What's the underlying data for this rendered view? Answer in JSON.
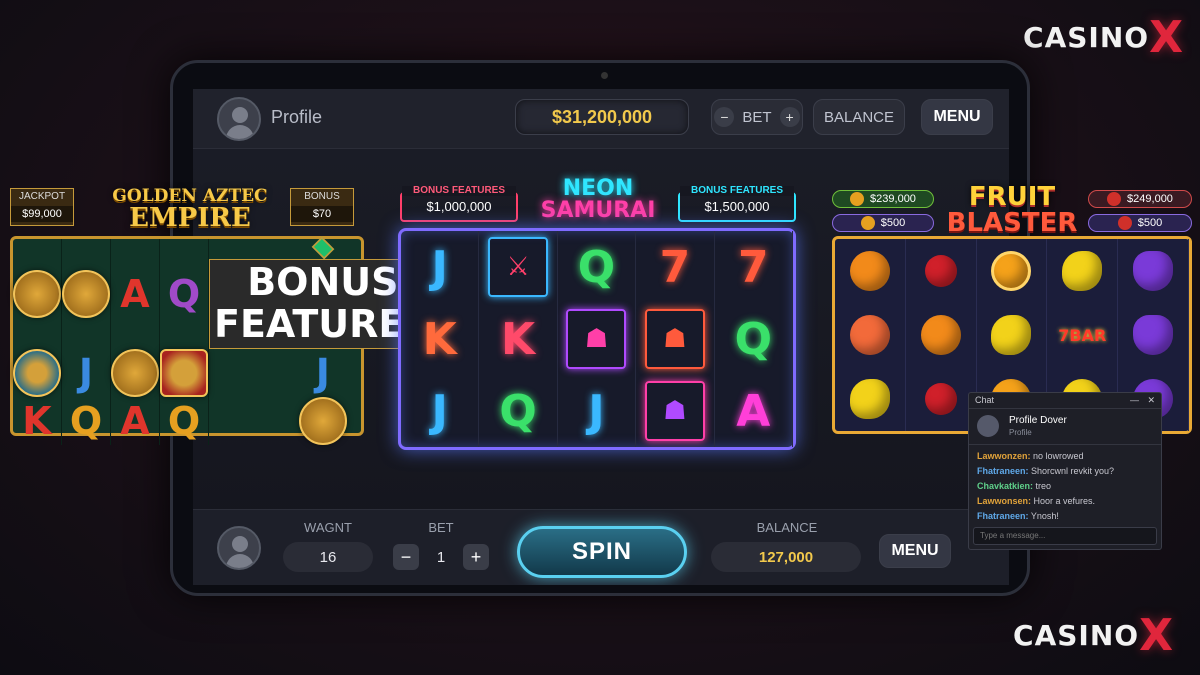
{
  "brand": {
    "logo_text": "CASINO",
    "logo_mark": "X"
  },
  "topbar": {
    "profile_label": "Profile",
    "jackpot_value": "$31,200,000",
    "bet_label": "BET",
    "minus": "−",
    "plus": "+",
    "balance_label": "BALANCE",
    "menu_label": "MENU"
  },
  "aztec": {
    "title_line1": "GOLDEN AZTEC",
    "title_line2": "EMPIRE",
    "jackpot_label": "JACKPOT",
    "jackpot_value": "$99,000",
    "bonus_label": "BONUS",
    "bonus_value": "$70",
    "bonus_cell_l1": "BONUS",
    "bonus_cell_l2": "FEATURES",
    "letters": [
      "A",
      "Q",
      "J",
      "J",
      "K",
      "Q",
      "A",
      "Q"
    ]
  },
  "neon": {
    "title_line1": "NEON",
    "title_line2": "SAMURAI",
    "left_tag_label": "BONUS FEATURES",
    "left_tag_value": "$1,000,000",
    "right_tag_label": "BONUS FEATURES",
    "right_tag_value": "$1,500,000",
    "cells": [
      "J",
      "⚔",
      "Q",
      "7",
      "7",
      "K",
      "K",
      "☗",
      "☗",
      "Q",
      "J",
      "Q",
      "J",
      "☗",
      "A"
    ]
  },
  "fruit": {
    "title_line1": "FRUIT",
    "title_line2": "BLASTER",
    "tag1": "$239,000",
    "tag2": "$500",
    "tag3": "$249,000",
    "tag4": "$500",
    "seven_label": "7BAR"
  },
  "bottombar": {
    "wager_label": "WAGNT",
    "wager_value": "16",
    "bet_label": "BET",
    "bet_value": "1",
    "minus": "−",
    "plus": "+",
    "spin_label": "SPIN",
    "balance_label": "BALANCE",
    "balance_value": "127,000",
    "menu_label": "MENU"
  },
  "chat": {
    "title": "Chat",
    "minimize": "—",
    "close": "✕",
    "user_name": "Profile Dover",
    "user_sub": "Profile",
    "messages": [
      {
        "name": "Lawwonzen:",
        "text": "no lowrowed",
        "color": "#e0a23a"
      },
      {
        "name": "Fhatraneen:",
        "text": "Shorcwnl revkit you?",
        "color": "#5fa8e8"
      },
      {
        "name": "Chavkatkien:",
        "text": "treo",
        "color": "#5fd08a"
      },
      {
        "name": "Lawwonsen:",
        "text": "Hoor a vefures.",
        "color": "#e0a23a"
      },
      {
        "name": "Fhatraneen:",
        "text": "Ynosh!",
        "color": "#5fa8e8"
      }
    ],
    "input_placeholder": "Type a message..."
  },
  "colors": {
    "accent_red": "#e0263c",
    "jackpot_gold": "#f2c94c",
    "spin_cyan": "#5ad0f0",
    "neon_cyan": "#2fe6ff",
    "neon_pink": "#ff3fa8"
  }
}
